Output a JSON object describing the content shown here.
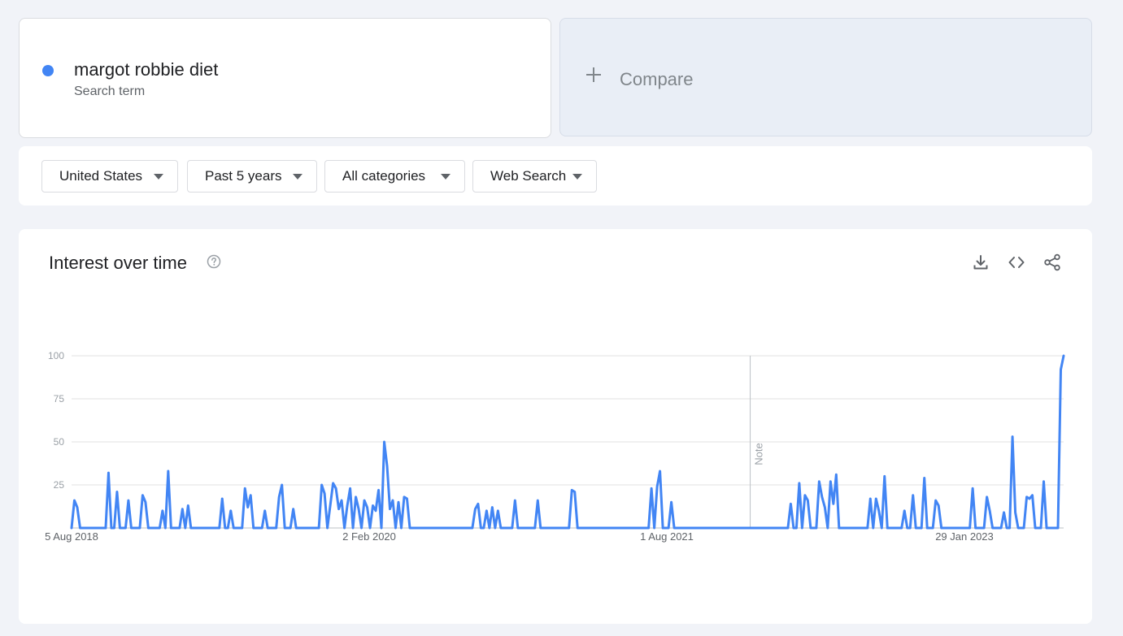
{
  "search_term": {
    "name": "margot robbie diet",
    "subtitle": "Search term",
    "color": "#4285f4"
  },
  "compare": {
    "label": "Compare"
  },
  "filters": [
    {
      "label": "United States"
    },
    {
      "label": "Past 5 years"
    },
    {
      "label": "All categories"
    },
    {
      "label": "Web Search"
    }
  ],
  "chart": {
    "title": "Interest over time",
    "note_label": "Note"
  },
  "colors": {
    "line": "#4285f4",
    "grid": "#e0e0e0"
  },
  "chart_data": {
    "type": "line",
    "series": [
      {
        "name": "margot robbie diet",
        "color": "#4285f4"
      }
    ],
    "x_start": "5 Aug 2018",
    "x_end": "2023-07-30",
    "ylim": [
      0,
      100
    ],
    "y_ticks": [
      25,
      50,
      75,
      100
    ],
    "x_ticks": [
      "5 Aug 2018",
      "2 Feb 2020",
      "1 Aug 2021",
      "29 Jan 2023"
    ],
    "note_date": "2022-01-01",
    "grid": true,
    "values": [
      0,
      16,
      12,
      0,
      0,
      0,
      0,
      0,
      0,
      0,
      0,
      0,
      0,
      32,
      0,
      0,
      21,
      0,
      0,
      0,
      16,
      0,
      0,
      0,
      0,
      19,
      15,
      0,
      0,
      0,
      0,
      0,
      10,
      0,
      33,
      0,
      0,
      0,
      0,
      11,
      0,
      13,
      0,
      0,
      0,
      0,
      0,
      0,
      0,
      0,
      0,
      0,
      0,
      17,
      0,
      0,
      10,
      0,
      0,
      0,
      0,
      23,
      12,
      19,
      0,
      0,
      0,
      0,
      10,
      0,
      0,
      0,
      0,
      18,
      25,
      0,
      0,
      0,
      11,
      0,
      0,
      0,
      0,
      0,
      0,
      0,
      0,
      0,
      25,
      20,
      0,
      13,
      26,
      23,
      11,
      16,
      0,
      13,
      23,
      0,
      18,
      11,
      0,
      16,
      12,
      0,
      13,
      10,
      22,
      0,
      50,
      36,
      11,
      16,
      0,
      15,
      0,
      18,
      17,
      0,
      0,
      0,
      0,
      0,
      0,
      0,
      0,
      0,
      0,
      0,
      0,
      0,
      0,
      0,
      0,
      0,
      0,
      0,
      0,
      0,
      0,
      0,
      11,
      14,
      0,
      0,
      10,
      0,
      12,
      0,
      10,
      0,
      0,
      0,
      0,
      0,
      16,
      0,
      0,
      0,
      0,
      0,
      0,
      0,
      16,
      0,
      0,
      0,
      0,
      0,
      0,
      0,
      0,
      0,
      0,
      0,
      22,
      21,
      0,
      0,
      0,
      0,
      0,
      0,
      0,
      0,
      0,
      0,
      0,
      0,
      0,
      0,
      0,
      0,
      0,
      0,
      0,
      0,
      0,
      0,
      0,
      0,
      0,
      0,
      23,
      0,
      24,
      33,
      0,
      0,
      0,
      15,
      0,
      0,
      0,
      0,
      0,
      0,
      0,
      0,
      0,
      0,
      0,
      0,
      0,
      0,
      0,
      0,
      0,
      0,
      0,
      0,
      0,
      0,
      0,
      0,
      0,
      0,
      0,
      0,
      0,
      0,
      0,
      0,
      0,
      0,
      0,
      0,
      0,
      0,
      0,
      0,
      0,
      14,
      0,
      0,
      26,
      0,
      19,
      16,
      0,
      0,
      0,
      27,
      18,
      12,
      0,
      27,
      14,
      31,
      0,
      0,
      0,
      0,
      0,
      0,
      0,
      0,
      0,
      0,
      0,
      17,
      0,
      17,
      10,
      0,
      30,
      0,
      0,
      0,
      0,
      0,
      0,
      10,
      0,
      0,
      19,
      0,
      0,
      0,
      29,
      0,
      0,
      0,
      16,
      13,
      0,
      0,
      0,
      0,
      0,
      0,
      0,
      0,
      0,
      0,
      0,
      23,
      0,
      0,
      0,
      0,
      18,
      10,
      0,
      0,
      0,
      0,
      9,
      0,
      0,
      53,
      9,
      0,
      0,
      0,
      18,
      17,
      19,
      0,
      0,
      0,
      27,
      0,
      0,
      0,
      0,
      0,
      92,
      100
    ]
  }
}
